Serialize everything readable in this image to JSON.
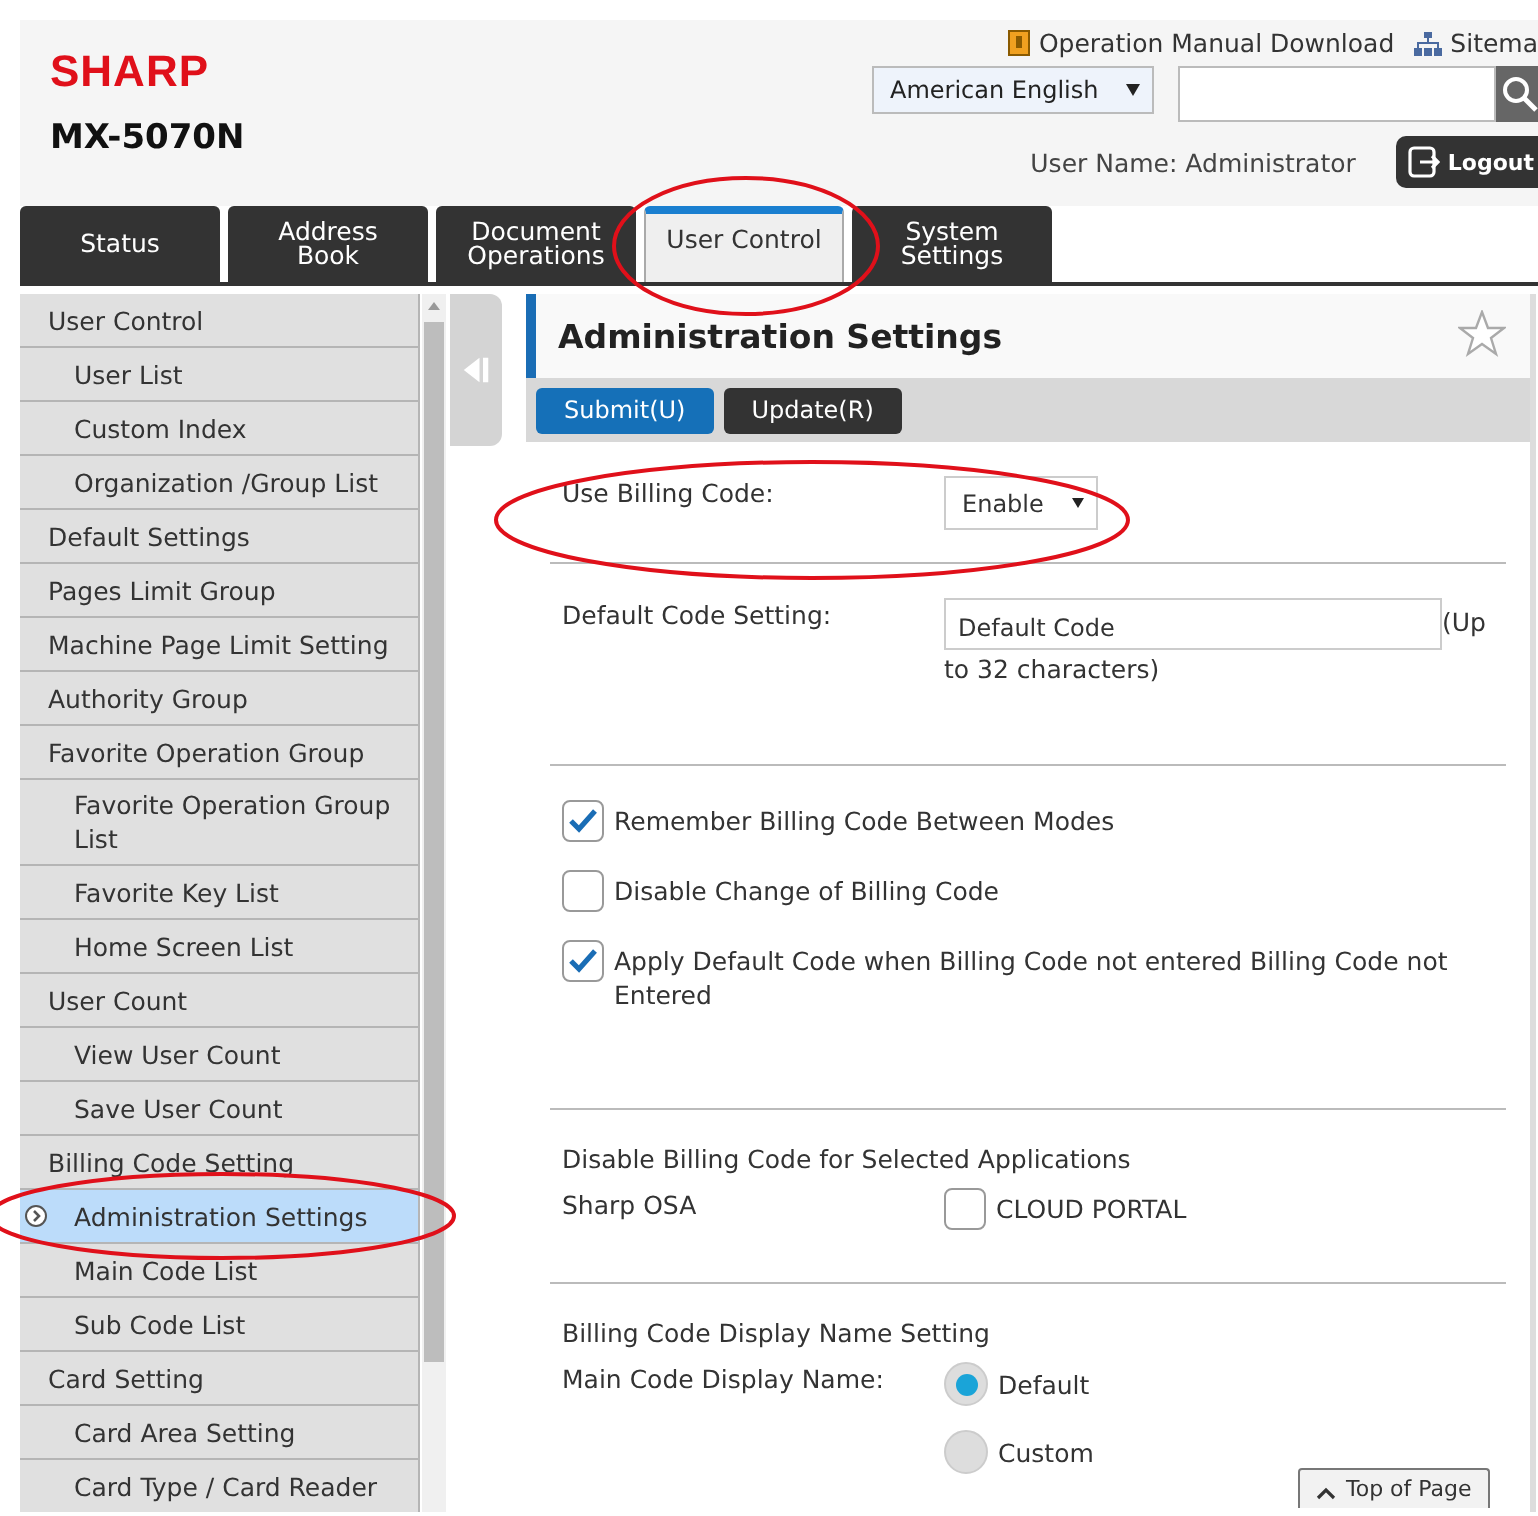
{
  "header": {
    "logo": "SHARP",
    "model": "MX-5070N",
    "links": [
      {
        "label": "Operation Manual Download",
        "kind": "manual"
      },
      {
        "label": "Sitema",
        "kind": "sitemap"
      }
    ],
    "language": {
      "value": "American English"
    },
    "user_name": "User Name: Administrator",
    "logout": "Logout"
  },
  "tabs": [
    {
      "label": "Status",
      "selected": false
    },
    {
      "label": "Address Book",
      "selected": false
    },
    {
      "label": "Document Operations",
      "selected": false
    },
    {
      "label": "User Control",
      "selected": true
    },
    {
      "label": "System Settings",
      "selected": false
    }
  ],
  "sidebar": {
    "items": [
      {
        "label": "User Control",
        "selected": false,
        "children": [
          {
            "label": "User List",
            "selected": false
          },
          {
            "label": "Custom Index",
            "selected": false
          },
          {
            "label": "Organization /Group List",
            "selected": false
          }
        ]
      },
      {
        "label": "Default Settings",
        "selected": false
      },
      {
        "label": "Pages Limit Group",
        "selected": false
      },
      {
        "label": "Machine Page Limit Setting",
        "selected": false
      },
      {
        "label": "Authority Group",
        "selected": false
      },
      {
        "label": "Favorite Operation Group",
        "selected": false,
        "children": [
          {
            "label": "Favorite Operation Group List",
            "selected": false
          },
          {
            "label": "Favorite Key List",
            "selected": false
          },
          {
            "label": "Home Screen List",
            "selected": false
          }
        ]
      },
      {
        "label": "User Count",
        "selected": false,
        "children": [
          {
            "label": "View User Count",
            "selected": false
          },
          {
            "label": "Save User Count",
            "selected": false
          }
        ]
      },
      {
        "label": "Billing Code Setting",
        "selected": false,
        "children": [
          {
            "label": "Administration Settings",
            "selected": true
          },
          {
            "label": "Main Code List",
            "selected": false
          },
          {
            "label": "Sub Code List",
            "selected": false
          }
        ]
      },
      {
        "label": "Card Setting",
        "selected": false,
        "children": [
          {
            "label": "Card Area Setting",
            "selected": false
          },
          {
            "label": "Card Type / Card Reader",
            "selected": false
          }
        ]
      }
    ]
  },
  "main": {
    "title": "Administration Settings",
    "buttons": [
      {
        "label": "Submit(U)",
        "kind": "primary"
      },
      {
        "label": "Update(R)",
        "kind": "secondary"
      }
    ],
    "sections": [
      {
        "rows": [
          {
            "kind": "select",
            "label": "Use Billing Code:",
            "value": "Enable"
          }
        ]
      },
      {
        "rows": [
          {
            "kind": "text",
            "label": "Default Code Setting:",
            "value": "Default Code",
            "note": "(Up",
            "note_continued": "to 32 characters)"
          }
        ]
      },
      {
        "rows": [
          {
            "kind": "checkbox",
            "label": "Remember Billing Code Between Modes",
            "checked": true
          },
          {
            "kind": "checkbox",
            "label": "Disable Change of Billing Code",
            "checked": false
          },
          {
            "kind": "checkbox",
            "label": "Apply Default Code when Billing Code not entered Billing Code not Entered",
            "checked": true
          }
        ]
      },
      {
        "heading": "Disable Billing Code for Selected Applications",
        "rows": [
          {
            "kind": "option",
            "label": "Sharp OSA",
            "option": "CLOUD PORTAL",
            "checked": false
          }
        ]
      },
      {
        "heading": "Billing Code Display Name Setting",
        "rows": [
          {
            "kind": "radio",
            "label": "Main Code Display Name:",
            "options": [
              {
                "label": "Default",
                "selected": true
              },
              {
                "label": "Custom",
                "selected": false
              }
            ]
          }
        ]
      }
    ]
  },
  "top_of_page": "Top of Page"
}
